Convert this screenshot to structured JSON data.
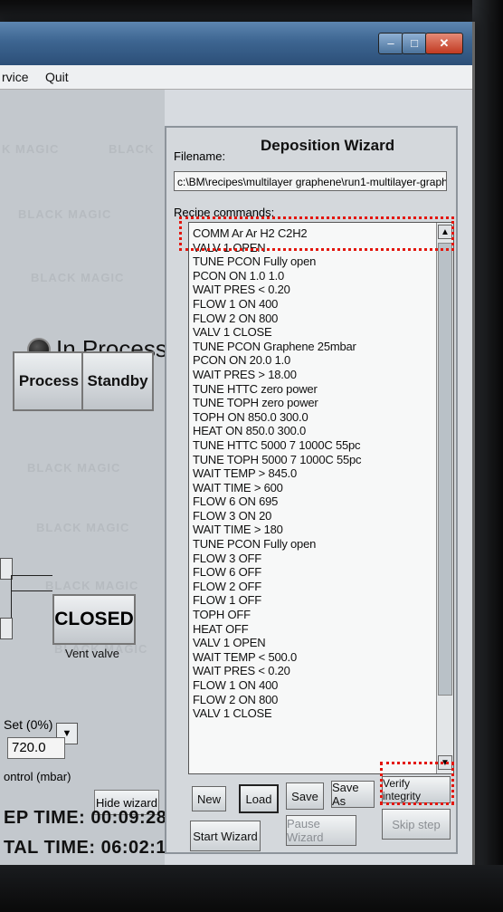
{
  "menu": {
    "service": "rvice",
    "quit": "Quit"
  },
  "watermark": [
    "K MAGIC",
    "BLACK",
    "BLACK MAGIC",
    "BLACK MAGIC",
    "BLACK MAGIC",
    "BLACK MAGIC",
    "BLACK MAGIC",
    "BLACK MAGIC"
  ],
  "status": {
    "indicator_label": "In Process"
  },
  "buttons": {
    "process": "Process",
    "standby": "Standby",
    "closed": "CLOSED",
    "hide_wizard": "Hide wizard"
  },
  "vent": {
    "label": "Vent valve"
  },
  "setpoint": {
    "label": "Set (0%)",
    "value": "720.0",
    "control_label": "ontrol (mbar)"
  },
  "times": {
    "step": "EP TIME: 00:09:28",
    "total": "TAL TIME: 06:02:12"
  },
  "wizard": {
    "title": "Deposition Wizard",
    "filename_label": "Filename:",
    "filename": "c:\\BM\\recipes\\multilayer graphene\\run1-multilayer-graphene-f",
    "recipe_label": "Recipe commands:",
    "commands": [
      "COMM Ar Ar H2 C2H2",
      "VALV 1 OPEN",
      "TUNE PCON Fully open",
      "PCON ON 1.0 1.0",
      "WAIT PRES < 0.20",
      "FLOW 1 ON 400",
      "FLOW 2 ON 800",
      "VALV 1 CLOSE",
      "TUNE PCON Graphene 25mbar",
      "PCON ON 20.0 1.0",
      "WAIT PRES > 18.00",
      "TUNE HTTC zero power",
      "TUNE TOPH zero power",
      "TOPH ON 850.0 300.0",
      "HEAT ON 850.0 300.0",
      "TUNE HTTC 5000 7 1000C 55pc",
      "TUNE TOPH 5000 7 1000C 55pc",
      "WAIT TEMP > 845.0",
      "WAIT TIME > 600",
      "FLOW 6 ON 695",
      "FLOW 3 ON 20",
      "WAIT TIME > 180",
      "TUNE PCON Fully open",
      "FLOW 3 OFF",
      "FLOW 6 OFF",
      "FLOW 2 OFF",
      "FLOW 1 OFF",
      "TOPH OFF",
      "HEAT OFF",
      "VALV 1 OPEN",
      "WAIT TEMP < 500.0",
      "WAIT PRES < 0.20",
      "FLOW 1 ON 400",
      "FLOW 2 ON 800",
      "VALV 1 CLOSE"
    ],
    "buttons": {
      "new": "New",
      "load": "Load",
      "save": "Save",
      "save_as": "Save As",
      "verify": "Verify integrity",
      "start": "Start Wizard",
      "pause": "Pause Wizard",
      "skip": "Skip step"
    }
  }
}
